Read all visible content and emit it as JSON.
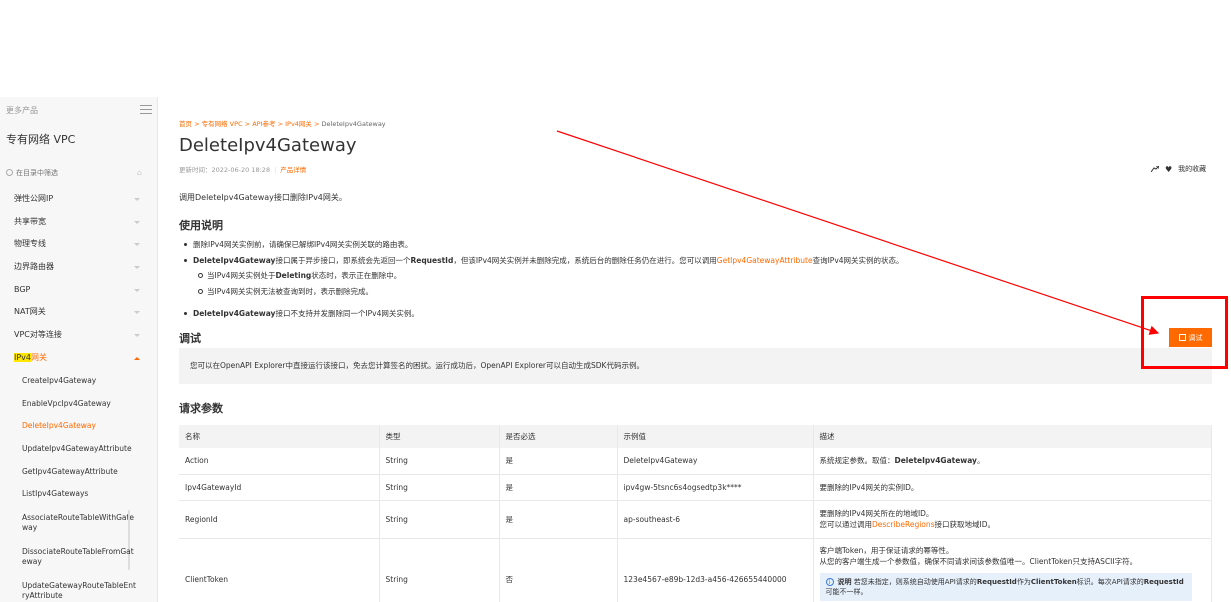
{
  "sidebar": {
    "more_products": "更多产品",
    "product_title": "专有网络 VPC",
    "search_placeholder": "在目录中筛选",
    "items": [
      {
        "label": "弹性公网IP"
      },
      {
        "label": "共享带宽"
      },
      {
        "label": "物理专线"
      },
      {
        "label": "边界路由器"
      },
      {
        "label": "BGP"
      },
      {
        "label": "NAT网关"
      },
      {
        "label": "VPC对等连接"
      }
    ],
    "open_item": {
      "highlight": "IPv4",
      "rest": "网关"
    },
    "sub_items": [
      "CreateIpv4Gateway",
      "EnableVpcIpv4Gateway",
      "DeleteIpv4Gateway",
      "UpdateIpv4GatewayAttribute",
      "GetIpv4GatewayAttribute",
      "ListIpv4Gateways",
      "AssociateRouteTableWithGateway",
      "DissociateRouteTableFromGateway",
      "UpdateGatewayRouteTableEntryAttribute"
    ]
  },
  "breadcrumb": {
    "parts": [
      "首页",
      "专有网络 VPC",
      "API参考",
      "IPv4网关"
    ],
    "current": "DeleteIpv4Gateway",
    "sep": ">"
  },
  "page": {
    "title": "DeleteIpv4Gateway",
    "updated": "更新时间：2022-06-20 18:28",
    "product_details": "产品详情",
    "favorite": "我的收藏",
    "intro": "调用DeleteIpv4Gateway接口删除IPv4网关。",
    "usage_heading": "使用说明",
    "usage": {
      "item1": "删除IPv4网关实例前，请确保已解绑IPv4网关实例关联的路由表。",
      "item2_bold": "DeleteIpv4Gateway",
      "item2_a": "接口属于异步接口，即系统会先返回一个",
      "item2_bold2": "RequestId",
      "item2_b": "，但该IPv4网关实例并未删除完成，系统后台的删除任务仍在进行。您可以调用",
      "item2_link": "GetIpv4GatewayAttribute",
      "item2_c": "查询IPv4网关实例的状态。",
      "sub1_a": "当IPv4网关实例处于",
      "sub1_bold": "Deleting",
      "sub1_b": "状态时，表示正在删除中。",
      "sub2": "当IPv4网关实例无法被查询到时，表示删除完成。",
      "item3_bold": "DeleteIpv4Gateway",
      "item3": "接口不支持并发删除同一个IPv4网关实例。"
    },
    "debug_heading": "调试",
    "debug_text": "您可以在OpenAPI Explorer中直接运行该接口，免去您计算签名的困扰。运行成功后，OpenAPI Explorer可以自动生成SDK代码示例。",
    "try_button": "调试",
    "params_heading": "请求参数"
  },
  "params_table": {
    "headers": [
      "名称",
      "类型",
      "是否必选",
      "示例值",
      "描述"
    ],
    "rows": [
      {
        "name": "Action",
        "type": "String",
        "required": "是",
        "example": "DeleteIpv4Gateway",
        "desc_a": "系统规定参数。取值：",
        "desc_bold": "DeleteIpv4Gateway",
        "desc_b": "。"
      },
      {
        "name": "Ipv4GatewayId",
        "type": "String",
        "required": "是",
        "example": "ipv4gw-5tsnc6s4ogsedtp3k****",
        "desc": "要删除的IPv4网关的实例ID。"
      },
      {
        "name": "RegionId",
        "type": "String",
        "required": "是",
        "example": "ap-southeast-6",
        "desc_line1": "要删除的IPv4网关所在的地域ID。",
        "desc_line2_a": "您可以通过调用",
        "desc_line2_link": "DescribeRegions",
        "desc_line2_b": "接口获取地域ID。"
      },
      {
        "name": "ClientToken",
        "type": "String",
        "required": "否",
        "example": "123e4567-e89b-12d3-a456-426655440000",
        "desc_line1": "客户端Token，用于保证请求的幂等性。",
        "desc_line2": "从您的客户端生成一个参数值，确保不同请求间该参数值唯一。ClientToken只支持ASCII字符。",
        "note_label": "说明",
        "note_a": "若您未指定，则系统自动使用API请求的",
        "note_bold1": "RequestId",
        "note_b": "作为",
        "note_bold2": "ClientToken",
        "note_c": "标识。每次API请求的",
        "note_bold3": "RequestId",
        "note_d": "可能不一样。"
      }
    ]
  },
  "colors": {
    "accent": "#ff6a00",
    "annotation": "#ff0000",
    "highlight": "#ffe600"
  }
}
